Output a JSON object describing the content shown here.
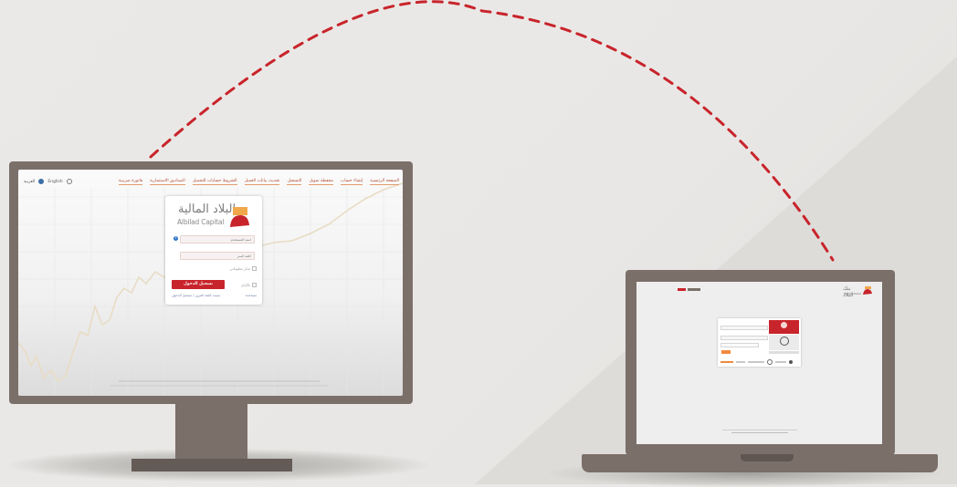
{
  "desktop": {
    "nav": [
      {
        "label": "الصفحة الرئيسية"
      },
      {
        "label": "إنشاء حساب"
      },
      {
        "label": "محفظة تمويل"
      },
      {
        "label": "التسجيل"
      },
      {
        "label": "تحديث بيانات العميل"
      },
      {
        "label": "الشروط حسابات للتحميل"
      },
      {
        "label": "الصناديق الاستثمارية"
      },
      {
        "label": "فاتورة ضريبية"
      }
    ],
    "lang": {
      "english": "English",
      "arabic": "العربية"
    },
    "login": {
      "logo_ar": "البلاد المالية",
      "logo_en": "Albilad Capital",
      "username_placeholder": "اسم المستخدم",
      "password_placeholder": "كلمة السر",
      "remember_label": "تذكر معلوماتي",
      "secure_label": "بالأمان",
      "login_button": "تسجيل الدخول",
      "help_icon": "?",
      "link_right": "مساعدة",
      "link_left": "نسيت كلمة المرور / تسجيل الدخول"
    },
    "colors": {
      "accent": "#c8242b",
      "nav": "#b44a2f",
      "frame": "#7b6f6a"
    }
  },
  "laptop": {
    "logo_ar": "بنك البلاد",
    "logo_en": "Bank Albilad"
  },
  "decor": {
    "arc_color": "#c8242b"
  }
}
